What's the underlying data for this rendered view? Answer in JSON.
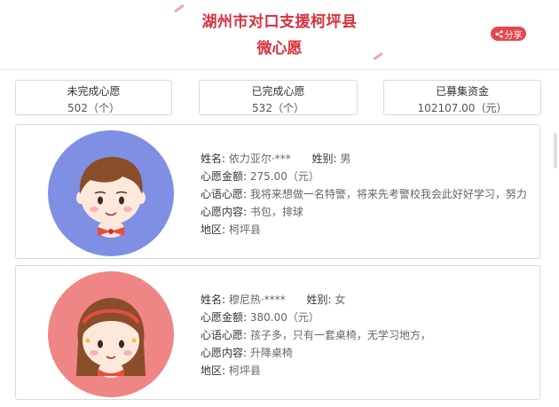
{
  "header": {
    "title_line1": "湖州市对口支援柯坪县",
    "title_line2": "微心愿",
    "share_label": "分享",
    "share_icon": "share-icon"
  },
  "stats": [
    {
      "label": "未完成心愿",
      "value": "502（个）"
    },
    {
      "label": "已完成心愿",
      "value": "532（个）"
    },
    {
      "label": "已募集资金",
      "value": "102107.00（元）"
    }
  ],
  "wishes": [
    {
      "avatar": "boy-avatar",
      "avatar_bg": "#7f8fe3",
      "name_key": "姓名:",
      "name": "依力亚尔·***",
      "gender_key": "姓别:",
      "gender": "男",
      "amount_key": "心愿金额:",
      "amount": "275.00（元）",
      "voice_key": "心语心愿:",
      "voice": "我将来想做一名特警，将来先考警校我会此好好学习，努力",
      "content_key": "心愿内容:",
      "content": "书包，排球",
      "region_key": "地区:",
      "region": "柯坪县"
    },
    {
      "avatar": "girl-avatar",
      "avatar_bg": "#ef8585",
      "name_key": "姓名:",
      "name": "穆尼热·****",
      "gender_key": "姓别:",
      "gender": "女",
      "amount_key": "心愿金额:",
      "amount": "380.00（元）",
      "voice_key": "心语心愿:",
      "voice": "孩子多，只有一套桌椅，无学习地方，",
      "content_key": "心愿内容:",
      "content": "升降桌椅",
      "region_key": "地区:",
      "region": "柯坪县"
    }
  ]
}
